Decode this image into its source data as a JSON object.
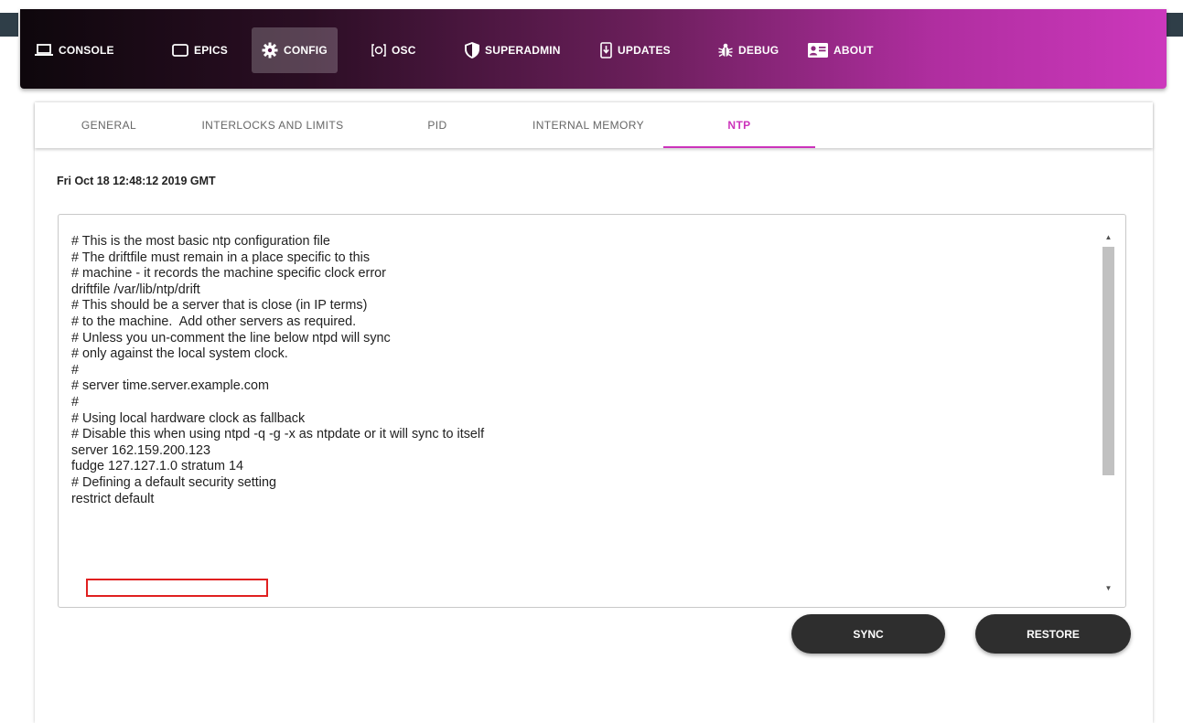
{
  "nav": {
    "items": [
      {
        "label": "CONSOLE",
        "icon": "laptop-icon"
      },
      {
        "label": "EPICS",
        "icon": "tablet-icon"
      },
      {
        "label": "CONFIG",
        "icon": "gear-icon",
        "active": true
      },
      {
        "label": "OSC",
        "icon": "oscilloscope-icon"
      },
      {
        "label": "SUPERADMIN",
        "icon": "shield-icon"
      },
      {
        "label": "UPDATES",
        "icon": "download-phone-icon"
      },
      {
        "label": "DEBUG",
        "icon": "bug-icon"
      },
      {
        "label": "ABOUT",
        "icon": "contact-card-icon"
      }
    ]
  },
  "tabs": [
    {
      "label": "GENERAL"
    },
    {
      "label": "INTERLOCKS AND LIMITS"
    },
    {
      "label": "PID"
    },
    {
      "label": "INTERNAL MEMORY"
    },
    {
      "label": "NTP",
      "active": true
    }
  ],
  "timestamp": "Fri Oct 18 12:48:12 2019 GMT",
  "ntp_config": "# This is the most basic ntp configuration file\n# The driftfile must remain in a place specific to this\n# machine - it records the machine specific clock error\ndriftfile /var/lib/ntp/drift\n# This should be a server that is close (in IP terms)\n# to the machine.  Add other servers as required.\n# Unless you un-comment the line below ntpd will sync\n# only against the local system clock.\n#\n# server time.server.example.com\n#\n# Using local hardware clock as fallback\n# Disable this when using ntpd -q -g -x as ntpdate or it will sync to itself\nserver 162.159.200.123\nfudge 127.127.1.0 stratum 14\n# Defining a default security setting\nrestrict default",
  "buttons": {
    "sync": "SYNC",
    "restore": "RESTORE"
  },
  "colors": {
    "accent": "#cc33bb",
    "highlight": "#e02020",
    "button_bg": "#2e2e2e"
  }
}
